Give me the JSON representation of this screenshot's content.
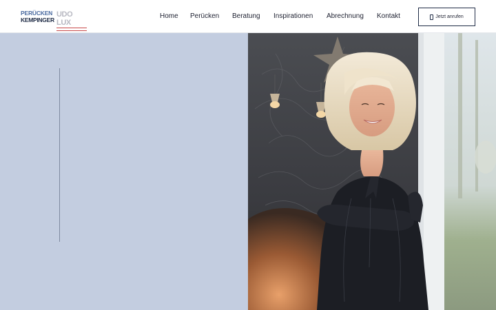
{
  "brand": {
    "logo_primary_line1": "PERÜCKEN",
    "logo_primary_line2": "KEMPINGER",
    "logo_secondary": "UDO LUX"
  },
  "nav": {
    "items": [
      {
        "label": "Home"
      },
      {
        "label": "Perücken"
      },
      {
        "label": "Beratung"
      },
      {
        "label": "Inspirationen"
      },
      {
        "label": "Abrechnung"
      },
      {
        "label": "Kontakt"
      }
    ]
  },
  "cta": {
    "label": "Jetzt anrufen",
    "icon": "phone-icon"
  },
  "colors": {
    "panel": "#c3cde0",
    "navy": "#1d2a44"
  }
}
